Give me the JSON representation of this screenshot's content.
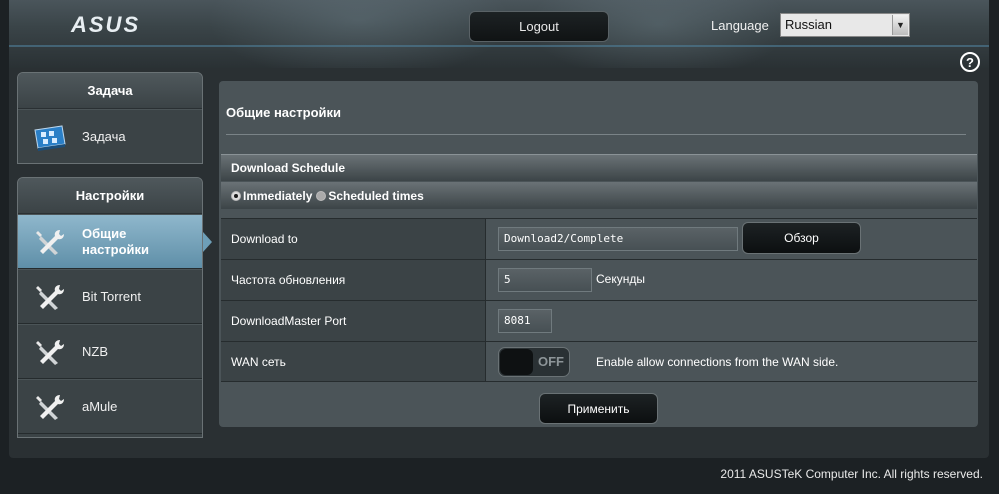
{
  "header": {
    "logo_text": "ASUS",
    "logout_label": "Logout",
    "language_label": "Language",
    "language_value": "Russian",
    "help_glyph": "?"
  },
  "sidebar": {
    "task_section": {
      "title": "Задача",
      "items": [
        {
          "label": "Задача",
          "icon": "task-icon"
        }
      ]
    },
    "settings_section": {
      "title": "Настройки",
      "items": [
        {
          "label": "Общие настройки",
          "icon": "tools-icon",
          "active": true
        },
        {
          "label": "Bit Torrent",
          "icon": "tools-icon"
        },
        {
          "label": "NZB",
          "icon": "tools-icon"
        },
        {
          "label": "aMule",
          "icon": "tools-icon"
        }
      ]
    }
  },
  "main": {
    "title": "Общие настройки",
    "schedule": {
      "header": "Download Schedule",
      "option_immediately": "Immediately",
      "option_scheduled": "Scheduled times",
      "selected": "Immediately"
    },
    "rows": {
      "download_to": {
        "label": "Download to",
        "value": "Download2/Complete",
        "browse_label": "Обзор"
      },
      "refresh": {
        "label": "Частота обновления",
        "value": "5",
        "unit": "Секунды"
      },
      "port": {
        "label": "DownloadMaster Port",
        "value": "8081"
      },
      "wan": {
        "label": "WAN сеть",
        "toggle_text": "OFF",
        "description": "Enable allow connections from the WAN side."
      }
    },
    "apply_label": "Применить"
  },
  "footer": {
    "copyright": "2011 ASUSTeK Computer Inc. All rights reserved."
  },
  "colors": {
    "accent": "#6e9fb8",
    "panel": "#4b5458",
    "background": "#1c2124"
  }
}
